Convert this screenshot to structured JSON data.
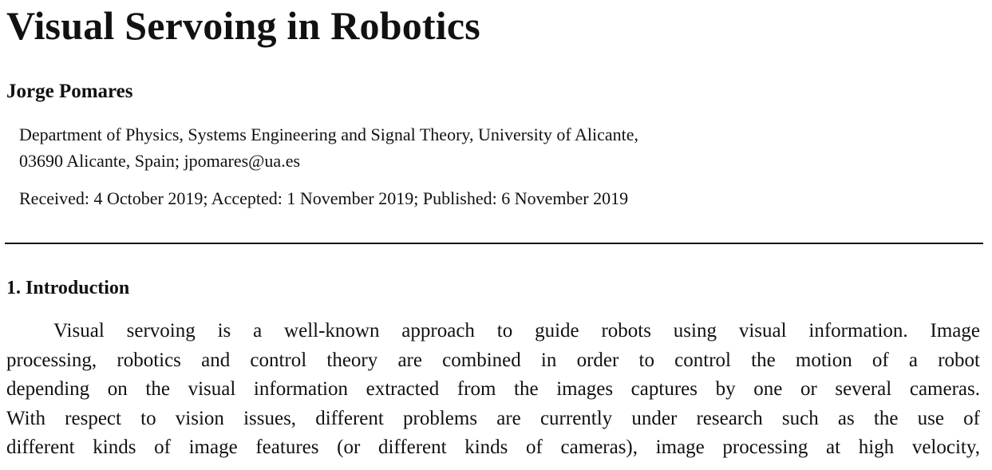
{
  "paper": {
    "title": "Visual Servoing in Robotics",
    "author": "Jorge Pomares",
    "affiliation_lines": [
      "Department of Physics, Systems Engineering and Signal Theory, University of Alicante,",
      "03690 Alicante, Spain; jpomares@ua.es"
    ],
    "dates": "Received: 4 October 2019; Accepted: 1 November 2019; Published: 6 November 2019",
    "section": {
      "heading": "1. Introduction",
      "lines": [
        "Visual servoing is a well-known approach to guide robots using visual information. Image",
        "processing, robotics and control theory are combined in order to control the motion of a robot",
        "depending on the visual information extracted from the images captures by one or several cameras.",
        "With respect to vision issues, different problems are currently under research such as the use of",
        "different kinds of image features (or different kinds of cameras), image processing at high velocity,"
      ]
    }
  }
}
